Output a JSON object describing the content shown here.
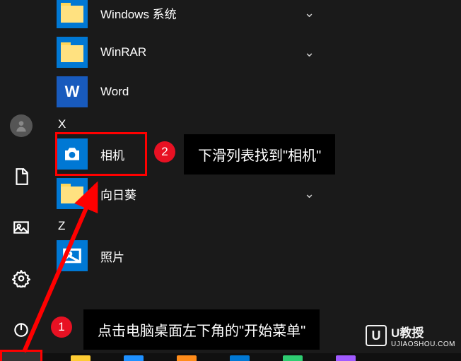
{
  "apps": {
    "windows_system": "Windows 系统",
    "winrar": "WinRAR",
    "word": "Word",
    "camera": "相机",
    "sunflower": "向日葵",
    "photos": "照片"
  },
  "sections": {
    "x": "X",
    "z": "Z"
  },
  "annotations": {
    "badge1": "1",
    "badge2": "2",
    "callout1": "点击电脑桌面左下角的\"开始菜单\"",
    "callout2": "下滑列表找到\"相机\""
  },
  "watermark": {
    "icon": "U",
    "title": "U教授",
    "sub": "UJIAOSHOU.COM"
  },
  "word_glyph": "W"
}
